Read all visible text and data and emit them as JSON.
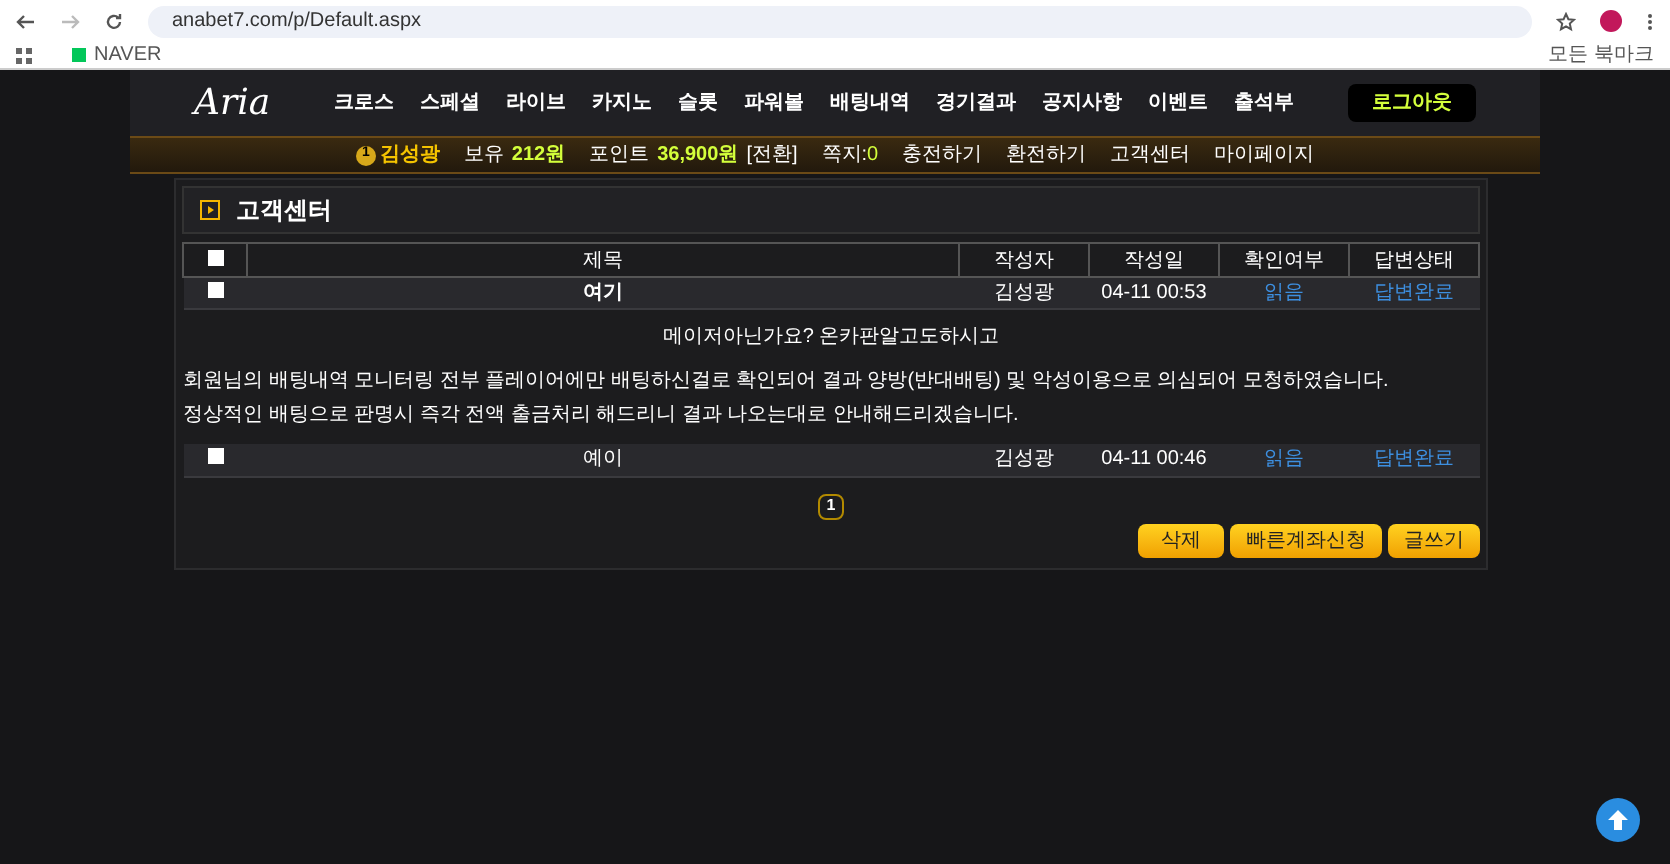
{
  "browser": {
    "url": "anabet7.com/p/Default.aspx",
    "bookmark": "NAVER",
    "all_bookmarks": "모든 북마크"
  },
  "logo": "Aria",
  "nav": {
    "items": [
      "크로스",
      "스페셜",
      "라이브",
      "카지노",
      "슬롯",
      "파워볼",
      "배팅내역",
      "경기결과",
      "공지사항",
      "이벤트",
      "출석부"
    ],
    "logout": "로그아웃"
  },
  "userbar": {
    "level": "1",
    "name": "김성광",
    "balance_label": "보유",
    "balance": "212원",
    "point_label": "포인트",
    "point": "36,900원",
    "convert": "[전환]",
    "message_label": "쪽지:",
    "message_count": "0",
    "links": [
      "충전하기",
      "환전하기",
      "고객센터",
      "마이페이지"
    ]
  },
  "panel": {
    "title": "고객센터",
    "table": {
      "select_all": {
        "checked": false
      },
      "columns": [
        "제목",
        "작성자",
        "작성일",
        "확인여부",
        "답변상태"
      ],
      "rows": [
        {
          "checked": false,
          "expanded": true,
          "title": "여기",
          "author": "김성광",
          "date": "04-11 00:53",
          "read": "읽음",
          "status": "답변완료",
          "body": [
            "메이저아닌가요? 온카판알고도하시고",
            "회원님의 배팅내역 모니터링 전부 플레이어에만 배팅하신걸로 확인되어 결과 양방(반대배팅) 및 악성이용으로 의심되어 모청하였습니다.",
            "정상적인 배팅으로 판명시 즉각 전액 출금처리 해드리니 결과 나오는대로 안내해드리겠습니다."
          ]
        },
        {
          "checked": false,
          "expanded": false,
          "title": "예이",
          "author": "김성광",
          "date": "04-11 00:46",
          "read": "읽음",
          "status": "답변완료",
          "body": []
        }
      ]
    },
    "pages": [
      {
        "label": "1",
        "selected": true
      }
    ],
    "buttons": [
      "삭제",
      "빠른계좌신청",
      "글쓰기"
    ]
  }
}
